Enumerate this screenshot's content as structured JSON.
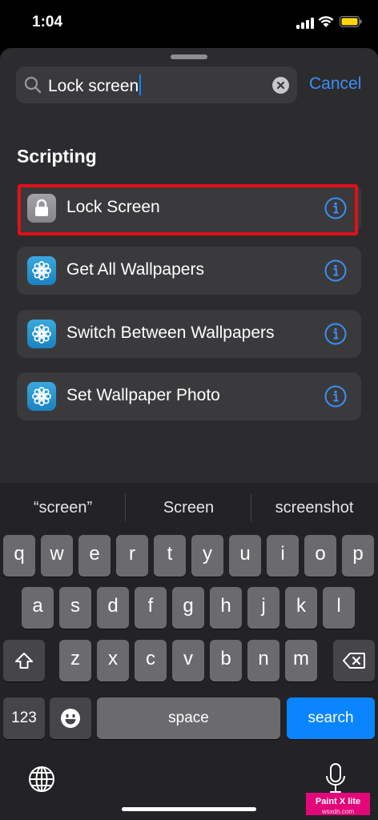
{
  "status_bar": {
    "time": "1:04"
  },
  "search": {
    "query": "Lock screen",
    "cancel_label": "Cancel"
  },
  "section": {
    "title": "Scripting"
  },
  "results": [
    {
      "label": "Lock Screen",
      "icon": "lock-icon"
    },
    {
      "label": "Get All Wallpapers",
      "icon": "flower-icon"
    },
    {
      "label": "Switch Between Wallpapers",
      "icon": "flower-icon"
    },
    {
      "label": "Set Wallpaper Photo",
      "icon": "flower-icon"
    }
  ],
  "keyboard": {
    "suggestions": [
      "“screen”",
      "Screen",
      "screenshot"
    ],
    "row1": [
      "q",
      "w",
      "e",
      "r",
      "t",
      "y",
      "u",
      "i",
      "o",
      "p"
    ],
    "row2": [
      "a",
      "s",
      "d",
      "f",
      "g",
      "h",
      "j",
      "k",
      "l"
    ],
    "row3": [
      "z",
      "x",
      "c",
      "v",
      "b",
      "n",
      "m"
    ],
    "numbers_label": "123",
    "space_label": "space",
    "search_label": "search"
  },
  "watermark": {
    "line1": "Paint X lite",
    "line2": "wsxdn.com"
  },
  "colors": {
    "accent": "#0a84ff",
    "highlight": "#e0101a",
    "sheet": "#2c2c2e"
  }
}
